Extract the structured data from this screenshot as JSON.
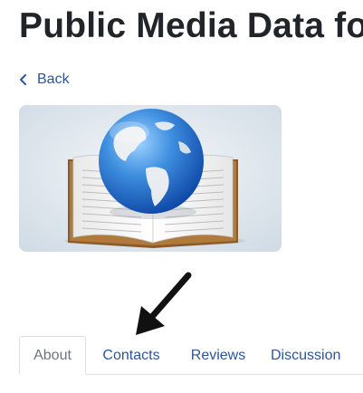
{
  "page": {
    "title": "Public Media Data fo"
  },
  "nav": {
    "back_label": "Back",
    "back_icon": "chevron-left-icon"
  },
  "hero": {
    "image": "globe-on-open-book-illustration"
  },
  "annotation": {
    "icon": "arrow-pointer-icon"
  },
  "tabs": [
    {
      "label": "About",
      "active": true
    },
    {
      "label": "Contacts",
      "active": false
    },
    {
      "label": "Reviews",
      "active": false
    },
    {
      "label": "Discussion",
      "active": false
    }
  ],
  "colors": {
    "link": "#2d5597",
    "title": "#212529",
    "tab_active_text": "#6c757d",
    "border": "#dee2e6"
  }
}
